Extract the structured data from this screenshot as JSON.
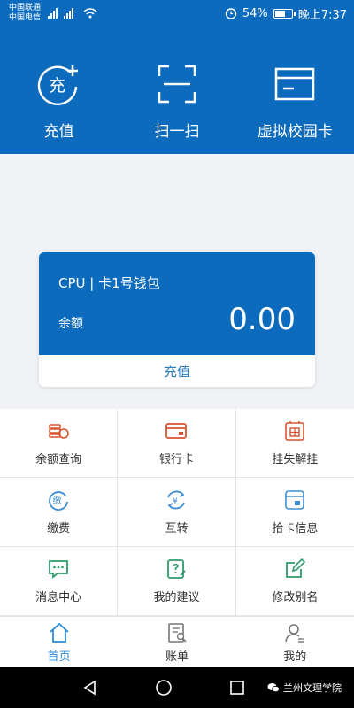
{
  "status_bar": {
    "carrier1": "中国联通",
    "carrier2": "中国电信",
    "battery": "54%",
    "battery_level": 0.54,
    "time": "晚上7:37"
  },
  "header": {
    "actions": [
      {
        "label": "充值",
        "icon": "recharge-icon"
      },
      {
        "label": "扫一扫",
        "icon": "scan-icon"
      },
      {
        "label": "虚拟校园卡",
        "icon": "virtual-card-icon"
      }
    ],
    "recharge_glyph": "充"
  },
  "card": {
    "title": "CPU | 卡1号钱包",
    "balance_label": "余额",
    "balance": "0.00",
    "action_label": "充值"
  },
  "grid": {
    "items": [
      {
        "label": "余额查询",
        "icon": "coins-icon"
      },
      {
        "label": "银行卡",
        "icon": "bank-card-icon"
      },
      {
        "label": "挂失解挂",
        "icon": "report-loss-icon"
      },
      {
        "label": "缴费",
        "icon": "payment-icon"
      },
      {
        "label": "互转",
        "icon": "transfer-icon"
      },
      {
        "label": "拾卡信息",
        "icon": "found-card-icon"
      },
      {
        "label": "消息中心",
        "icon": "message-icon"
      },
      {
        "label": "我的建议",
        "icon": "suggestion-icon"
      },
      {
        "label": "修改别名",
        "icon": "edit-alias-icon"
      }
    ],
    "payment_glyph": "缴",
    "transfer_glyph": "¥"
  },
  "tabbar": {
    "tabs": [
      {
        "label": "首页",
        "icon": "home-icon",
        "active": true
      },
      {
        "label": "账单",
        "icon": "bill-icon",
        "active": false
      },
      {
        "label": "我的",
        "icon": "profile-icon",
        "active": false
      }
    ]
  },
  "watermark": "兰州文理学院",
  "colors": {
    "primary": "#0d6bbd",
    "accent_red": "#d9532f",
    "accent_blue": "#3f8dd1",
    "accent_green": "#2e9b6b"
  }
}
